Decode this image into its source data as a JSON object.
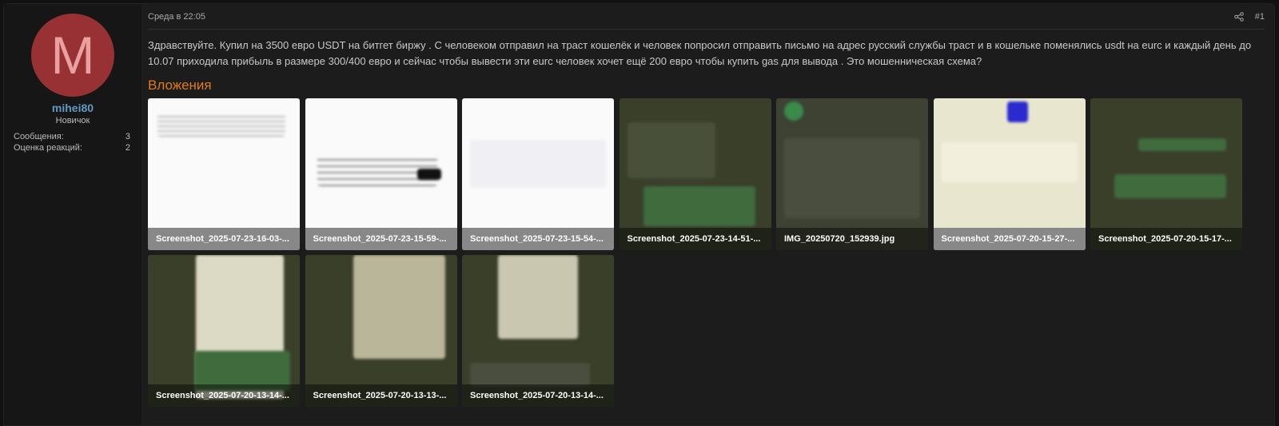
{
  "user": {
    "initial": "M",
    "name": "mihei80",
    "title": "Новичок",
    "stats": [
      {
        "label": "Сообщения:",
        "value": "3"
      },
      {
        "label": "Оценка реакций:",
        "value": "2"
      }
    ]
  },
  "post": {
    "date": "Среда в 22:05",
    "number": "#1",
    "share_icon": "share-icon",
    "text": "Здравствуйте. Купил на 3500 евро USDT на битгет биржу . С человеком отправил на траст кошелёк и человек попросил отправить письмо на адрес русский службы траст и в кошельке поменялись usdt на eurc и каждый день до 10.07 приходила прибыль в размере 300/400 евро и сейчас чтобы вывести эти eurc человек хочет ещё 200 евро чтобы купить gas для вывода . Это мошенническая схема?",
    "attachments_title": "Вложения",
    "attachments": [
      "Screenshot_2025-07-23-16-03-...",
      "Screenshot_2025-07-23-15-59-...",
      "Screenshot_2025-07-23-15-54-...",
      "Screenshot_2025-07-23-14-51-...",
      "IMG_20250720_152939.jpg",
      "Screenshot_2025-07-20-15-27-...",
      "Screenshot_2025-07-20-15-17-...",
      "Screenshot_2025-07-20-13-14-...",
      "Screenshot_2025-07-20-13-13-...",
      "Screenshot_2025-07-20-13-14-..."
    ]
  },
  "colors": {
    "accent": "#e07b1a",
    "username": "#5e9ac2",
    "avatar": "#983133"
  }
}
